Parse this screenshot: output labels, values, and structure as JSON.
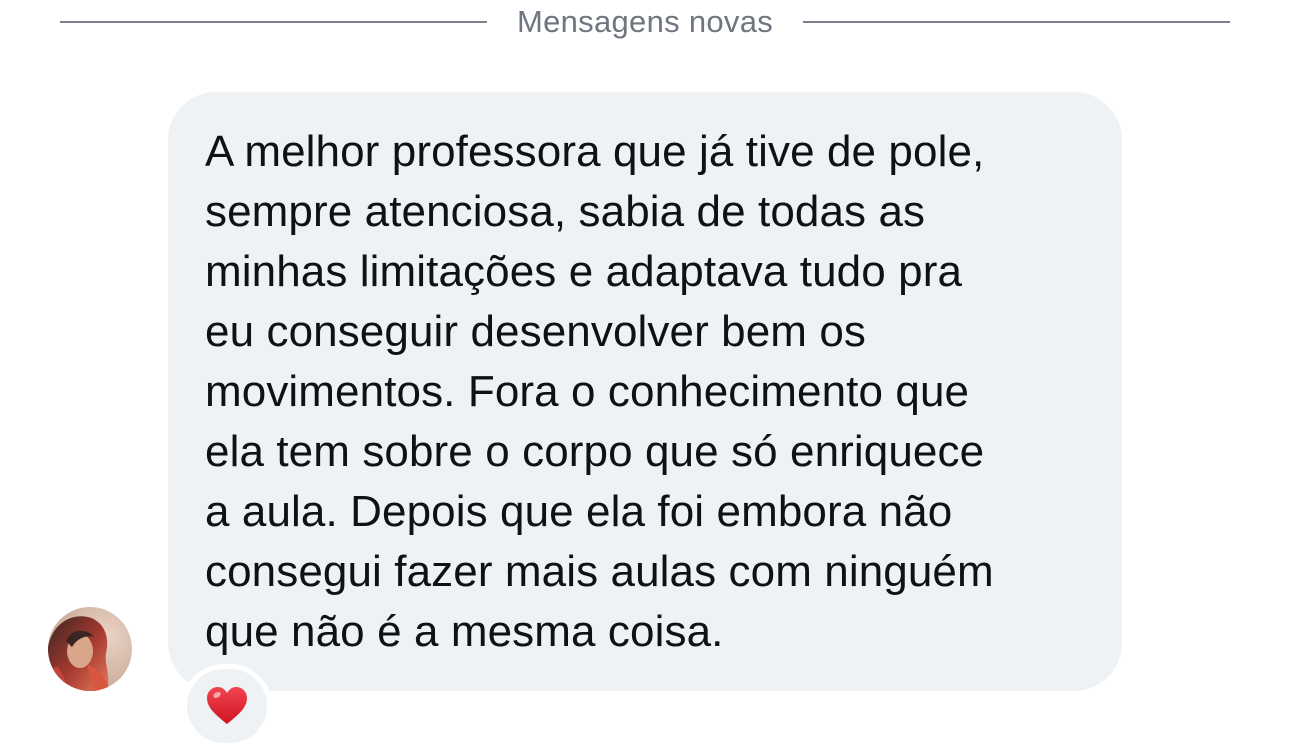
{
  "divider": {
    "label": "Mensagens novas"
  },
  "message": {
    "text": "A melhor professora que já tive de pole,\nsempre atenciosa, sabia de todas as\nminhas limitações e adaptava tudo pra\neu conseguir desenvolver bem os\nmovimentos. Fora o conhecimento que\nela tem sobre o corpo que só enriquece\na aula. Depois que ela foi embora não\nconsegui fazer mais aulas com ninguém\nque não é a mesma coisa."
  },
  "reaction": {
    "icon": "heart-icon",
    "color": "#e0202e"
  },
  "avatar": {
    "icon": "user-avatar"
  }
}
